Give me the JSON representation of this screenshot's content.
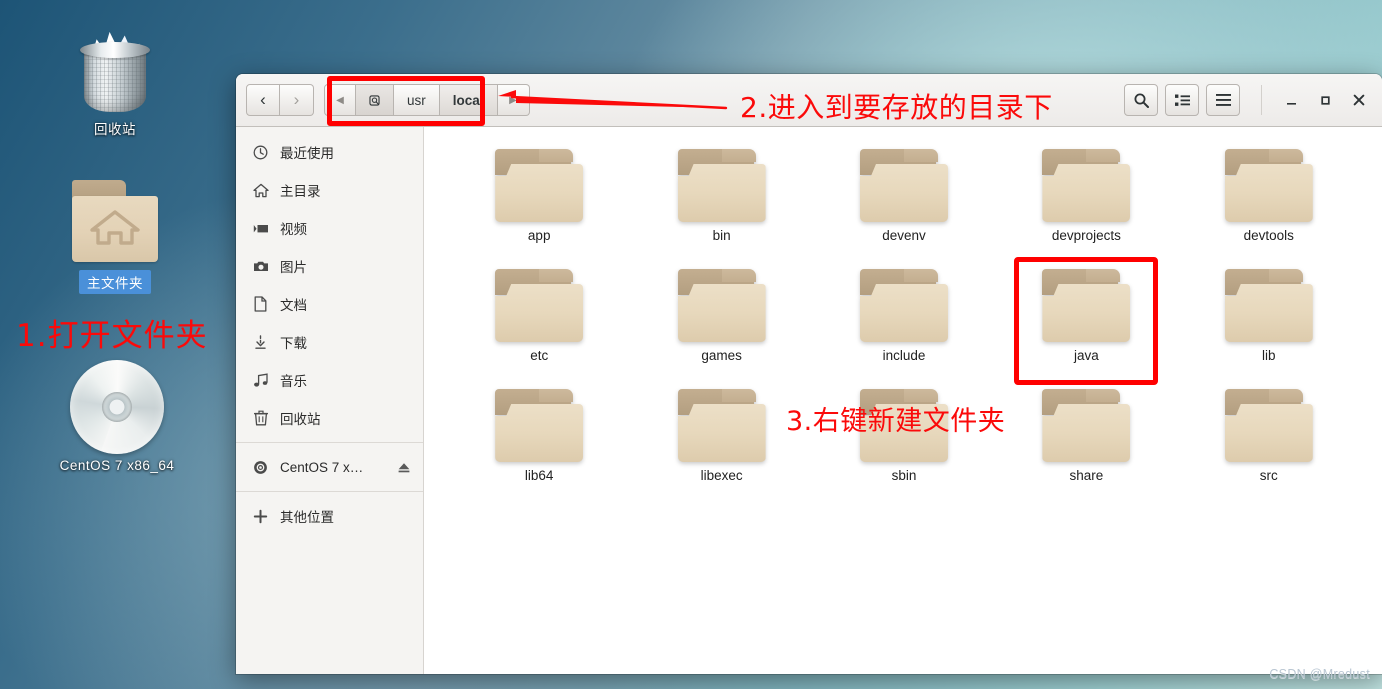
{
  "desktop": {
    "icons": [
      {
        "name": "trash",
        "label": "回收站",
        "selected": false
      },
      {
        "name": "home-folder",
        "label": "主文件夹",
        "selected": true
      },
      {
        "name": "cdrom",
        "label": "CentOS 7 x86_64",
        "selected": false
      }
    ]
  },
  "annotations": [
    {
      "id": "step-1",
      "text": "1.打开文件夹"
    },
    {
      "id": "step-2",
      "text": "2.进入到要存放的目录下"
    },
    {
      "id": "step-3",
      "text": "3.右键新建文件夹"
    }
  ],
  "window": {
    "nav": {
      "back_icon": "chevron-left-icon",
      "forward_icon": "chevron-right-icon"
    },
    "pathbar": {
      "left_scroll_icon": "triangle-left-icon",
      "right_scroll_icon": "triangle-right-icon",
      "root_icon": "filesystem-root-icon",
      "crumbs": [
        {
          "label": "usr",
          "current": false
        },
        {
          "label": "local",
          "current": true
        }
      ]
    },
    "toolbar": [
      {
        "name": "search-button",
        "icon": "search-icon",
        "glyph": "🔍"
      },
      {
        "name": "view-options-button",
        "icon": "list-view-icon",
        "glyph": ""
      },
      {
        "name": "menu-button",
        "icon": "hamburger-menu-icon",
        "glyph": "☰"
      }
    ],
    "window_controls": [
      {
        "name": "minimize-button",
        "icon": "minimize-icon",
        "glyph": "—"
      },
      {
        "name": "maximize-button",
        "icon": "maximize-icon",
        "glyph": "□"
      },
      {
        "name": "close-button",
        "icon": "close-icon",
        "glyph": "✕"
      }
    ],
    "sidebar": {
      "items": [
        {
          "label": "最近使用",
          "icon": "clock-icon"
        },
        {
          "label": "主目录",
          "icon": "home-icon"
        },
        {
          "label": "视频",
          "icon": "video-icon"
        },
        {
          "label": "图片",
          "icon": "camera-icon"
        },
        {
          "label": "文档",
          "icon": "document-icon"
        },
        {
          "label": "下载",
          "icon": "download-icon"
        },
        {
          "label": "音乐",
          "icon": "music-icon"
        },
        {
          "label": "回收站",
          "icon": "trash-icon"
        }
      ],
      "devices": [
        {
          "label": "CentOS 7 x…",
          "icon": "optical-disc-icon",
          "eject_icon": "eject-icon"
        }
      ],
      "other": {
        "label": "其他位置",
        "icon": "plus-icon"
      }
    },
    "files": [
      {
        "name": "app",
        "highlighted": false
      },
      {
        "name": "bin",
        "highlighted": false
      },
      {
        "name": "devenv",
        "highlighted": false
      },
      {
        "name": "devprojects",
        "highlighted": false
      },
      {
        "name": "devtools",
        "highlighted": false
      },
      {
        "name": "etc",
        "highlighted": false
      },
      {
        "name": "games",
        "highlighted": false
      },
      {
        "name": "include",
        "highlighted": false
      },
      {
        "name": "java",
        "highlighted": true
      },
      {
        "name": "lib",
        "highlighted": false
      },
      {
        "name": "lib64",
        "highlighted": false
      },
      {
        "name": "libexec",
        "highlighted": false
      },
      {
        "name": "sbin",
        "highlighted": false
      },
      {
        "name": "share",
        "highlighted": false
      },
      {
        "name": "src",
        "highlighted": false
      }
    ]
  },
  "watermark": "CSDN @Mredust",
  "colors": {
    "annotation_red": "#fb0a0a",
    "selection_blue": "#4a90d9",
    "folder_body": "#e7d8bc",
    "folder_tab": "#b39e80"
  }
}
